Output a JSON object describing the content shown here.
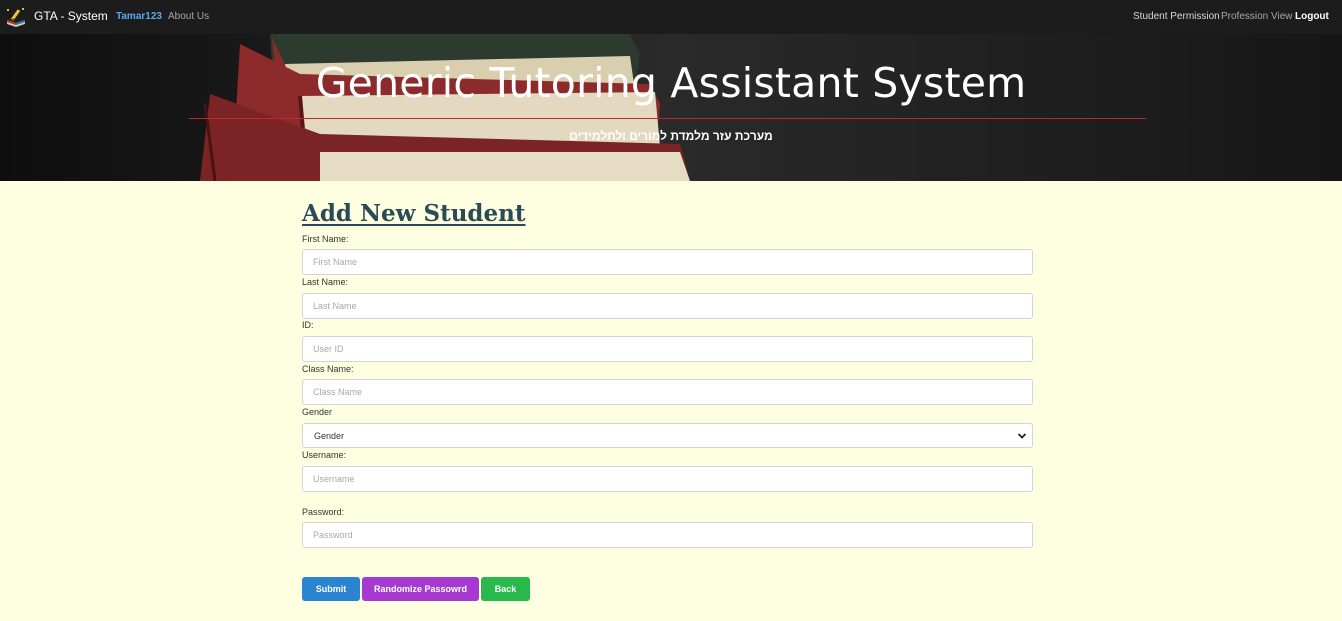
{
  "navbar": {
    "brand": "GTA - System",
    "brand_icon": "book-pencil-icon",
    "user": "Tamar123",
    "about": "About Us",
    "student_permission": "Student Permission",
    "profession_view": "Profession View",
    "logout": "Logout"
  },
  "hero": {
    "title": "Generic Tutoring Assistant System",
    "subtitle": "מערכת עזר מלמדת למורים ולתלמידים"
  },
  "form": {
    "title": "Add New Student",
    "first_name": {
      "label": "First Name:",
      "placeholder": "First Name"
    },
    "last_name": {
      "label": "Last Name:",
      "placeholder": "Last Name"
    },
    "id": {
      "label": "ID:",
      "placeholder": "User ID"
    },
    "class_name": {
      "label": "Class Name:",
      "placeholder": "Class Name"
    },
    "gender": {
      "label": "Gender",
      "value": "Gender"
    },
    "username": {
      "label": "Username:",
      "placeholder": "Username"
    },
    "password": {
      "label": "Password:",
      "placeholder": "Password"
    }
  },
  "buttons": {
    "submit": "Submit",
    "randomize": "Randomize Passowrd",
    "back": "Back"
  },
  "colors": {
    "page_background": "#fefee0",
    "navbar": "#1c1c1c",
    "title": "#2a4a55",
    "submit": "#2a84d2",
    "randomize": "#a63ad0",
    "back": "#28b84b",
    "hero_line": "#c0272d"
  }
}
